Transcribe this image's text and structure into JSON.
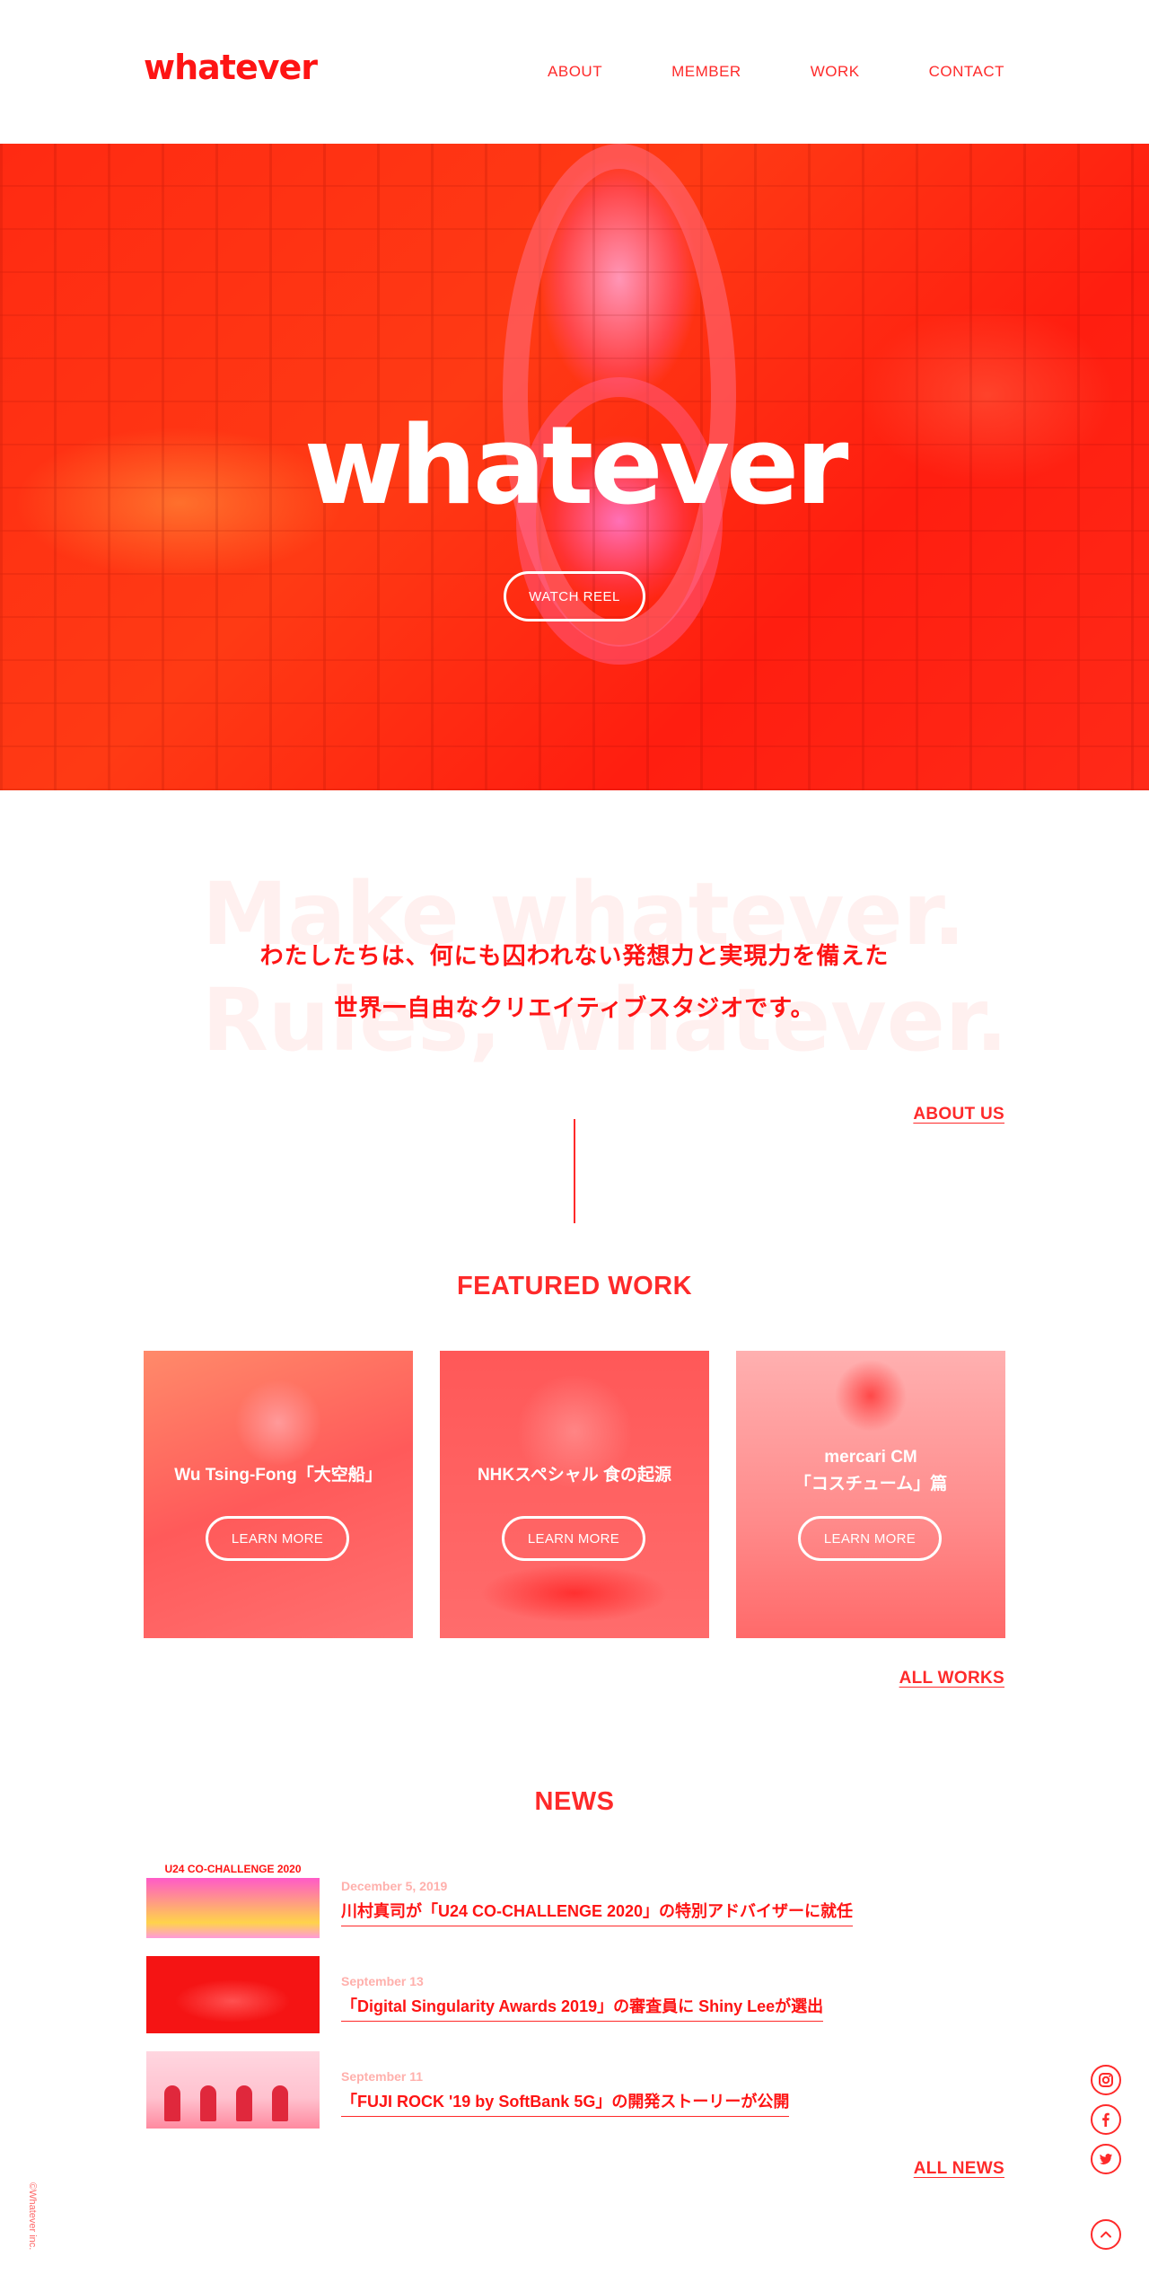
{
  "header": {
    "logo": "whatever",
    "nav": [
      "ABOUT",
      "MEMBER",
      "WORK",
      "CONTACT"
    ]
  },
  "hero": {
    "title": "whatever",
    "reel_button": "WATCH REEL"
  },
  "intro": {
    "bg_slogan_1": "Make whatever.",
    "bg_slogan_2": "Rules, whatever.",
    "line_1": "わたしたちは、何にも囚われない発想力と実現力を備えた",
    "line_2": "世界一自由なクリエイティブスタジオです。",
    "about_link": "ABOUT US"
  },
  "featured": {
    "title": "FEATURED WORK",
    "items": [
      {
        "title": "Wu Tsing-Fong「大空船」",
        "button": "LEARN MORE"
      },
      {
        "title": "NHKスペシャル 食の起源",
        "button": "LEARN MORE"
      },
      {
        "title_line1": "mercari CM",
        "title_line2": "「コスチューム」篇",
        "button": "LEARN MORE"
      }
    ],
    "all_link": "ALL WORKS"
  },
  "news": {
    "title": "NEWS",
    "items": [
      {
        "date": "December 5, 2019",
        "text": "川村真司が「U24 CO-CHALLENGE 2020」の特別アドバイザーに就任",
        "thumb_label": "U24 CO-CHALLENGE 2020"
      },
      {
        "date": "September 13",
        "text": "「Digital Singularity Awards 2019」の審査員に Shiny Leeが選出"
      },
      {
        "date": "September 11",
        "text": "「FUJI ROCK '19 by SoftBank 5G」の開発ストーリーが公開"
      }
    ],
    "all_link": "ALL NEWS"
  },
  "footer": {
    "copyright": "©Whatever inc."
  },
  "colors": {
    "accent": "#fe2a2a",
    "brand": "#fe1414",
    "slogan_bg": "#fff0ef"
  }
}
